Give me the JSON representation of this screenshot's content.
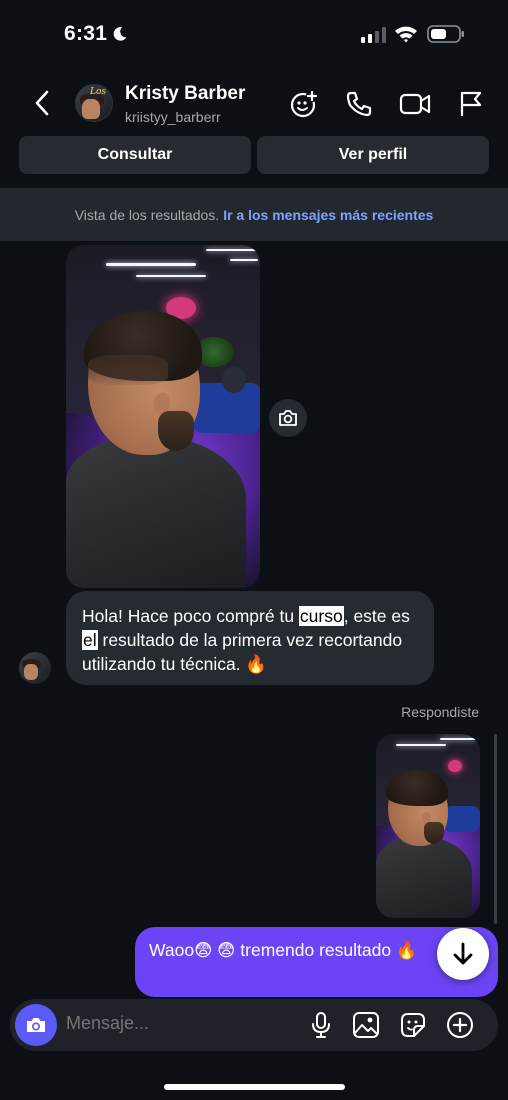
{
  "status_bar": {
    "time": "6:31",
    "icons": [
      "moon-icon",
      "signal-icon",
      "wifi-icon",
      "battery-icon"
    ]
  },
  "header": {
    "contact_name": "Kristy Barber",
    "username": "kriistyy_barberr",
    "avatar_text": "Los",
    "icons": [
      "back-icon",
      "face-add-icon",
      "phone-icon",
      "video-icon",
      "flag-icon"
    ]
  },
  "actions": {
    "consult_label": "Consultar",
    "profile_label": "Ver perfil"
  },
  "banner": {
    "text": "Vista de los resultados.",
    "link": "Ir a los mensajes más recientes"
  },
  "messages": {
    "received": {
      "part1": "Hola! Hace poco compré tu ",
      "highlight1": "curso",
      "part2": ", este es ",
      "highlight2": "el",
      "part3": " resultado de la primera vez recortando utilizando tu técnica. 🔥"
    },
    "replied_label": "Respondiste",
    "sent": {
      "text": "Waoo😨 😨  tremendo resultado 🔥"
    }
  },
  "composer": {
    "placeholder": "Mensaje...",
    "icons": [
      "camera-icon",
      "microphone-icon",
      "gallery-icon",
      "sticker-icon",
      "add-icon"
    ]
  },
  "colors": {
    "background": "#0c1014",
    "bubble_in": "#262a31",
    "bubble_out": "#6b45f5",
    "link": "#7ea2ff",
    "composer_camera": "#5b5bf7"
  }
}
